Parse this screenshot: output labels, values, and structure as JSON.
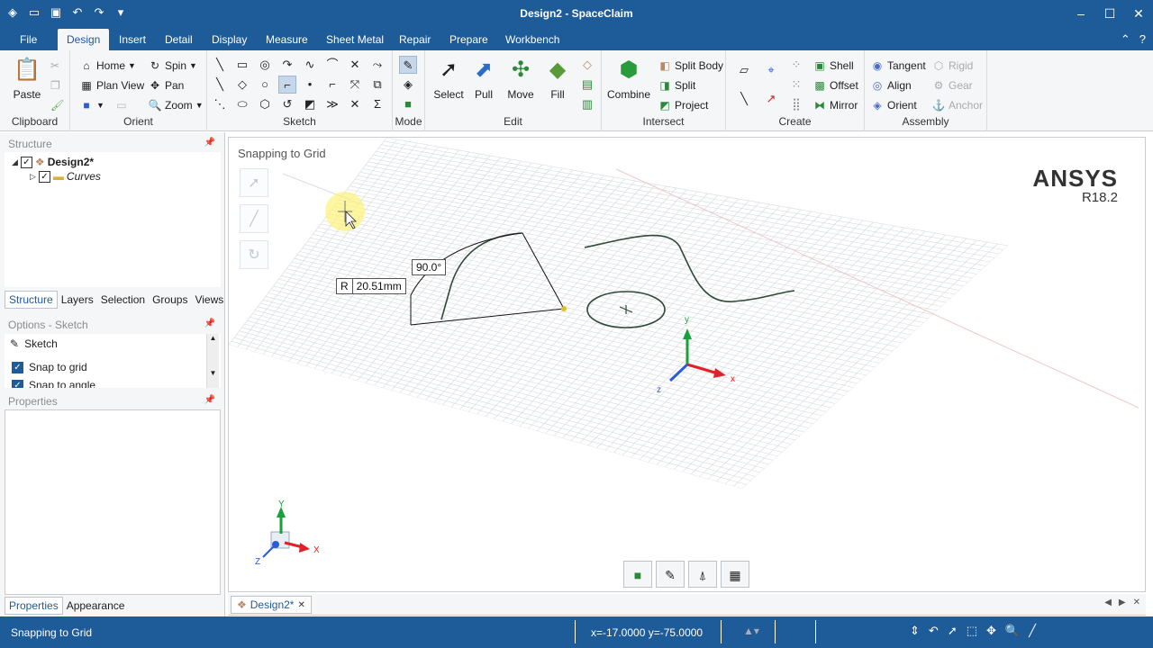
{
  "window": {
    "title": "Design2 - SpaceClaim",
    "controls": [
      "–",
      "☐",
      "✕"
    ]
  },
  "quick_access": [
    "file-open-icon",
    "save-icon",
    "undo-icon",
    "redo-icon",
    "customize-icon"
  ],
  "menu": {
    "tabs": [
      "File",
      "Design",
      "Insert",
      "Detail",
      "Display",
      "Measure",
      "Sheet Metal",
      "Repair",
      "Prepare",
      "Workbench"
    ],
    "active": "Design",
    "right_glyphs": [
      "⌃",
      "?"
    ]
  },
  "ribbon": {
    "clipboard": {
      "label": "Clipboard",
      "paste": "Paste"
    },
    "orient": {
      "label": "Orient",
      "home": "Home",
      "plan_view": "Plan View",
      "spin": "Spin",
      "pan": "Pan",
      "zoom": "Zoom"
    },
    "sketch": {
      "label": "Sketch"
    },
    "mode": {
      "label": "Mode"
    },
    "edit": {
      "label": "Edit",
      "select": "Select",
      "pull": "Pull",
      "move": "Move",
      "fill": "Fill"
    },
    "intersect": {
      "label": "Intersect",
      "combine": "Combine",
      "split_body": "Split Body",
      "split": "Split",
      "project": "Project"
    },
    "create": {
      "label": "Create",
      "shell": "Shell",
      "offset": "Offset",
      "mirror": "Mirror"
    },
    "assembly": {
      "label": "Assembly",
      "tangent": "Tangent",
      "align": "Align",
      "orient": "Orient",
      "rigid": "Rigid",
      "gear": "Gear",
      "anchor": "Anchor"
    }
  },
  "structure": {
    "header": "Structure",
    "root": "Design2*",
    "child": "Curves",
    "tabs": [
      "Structure",
      "Layers",
      "Selection",
      "Groups",
      "Views"
    ],
    "active_tab": "Structure"
  },
  "options": {
    "header": "Options - Sketch",
    "title": "Sketch",
    "items": [
      {
        "label": "Snap to grid",
        "checked": true
      },
      {
        "label": "Snap to angle",
        "checked": true
      }
    ]
  },
  "properties": {
    "header": "Properties",
    "tabs": [
      "Properties",
      "Appearance"
    ],
    "active_tab": "Properties"
  },
  "viewport": {
    "hint": "Snapping to Grid",
    "brand": "ANSYS",
    "version": "R18.2",
    "angle_label": "90.0°",
    "radius_prefix": "R",
    "radius_value": "20.51mm",
    "axis_x": "x",
    "axis_y": "y",
    "axis_z": "z",
    "axis_labels_big": {
      "x": "X",
      "y": "Y",
      "z": "Z"
    }
  },
  "document_tab": {
    "label": "Design2*",
    "close": "✕"
  },
  "status": {
    "message": "Snapping to Grid",
    "coords": "x=-17.0000  y=-75.0000"
  },
  "colors": {
    "title_bar": "#1d5b99",
    "ribbon": "#f5f6f7",
    "curve": "#2e4a35",
    "axis_x": "#e0202a",
    "axis_y": "#1aa03a",
    "axis_z": "#2a5bd8"
  }
}
